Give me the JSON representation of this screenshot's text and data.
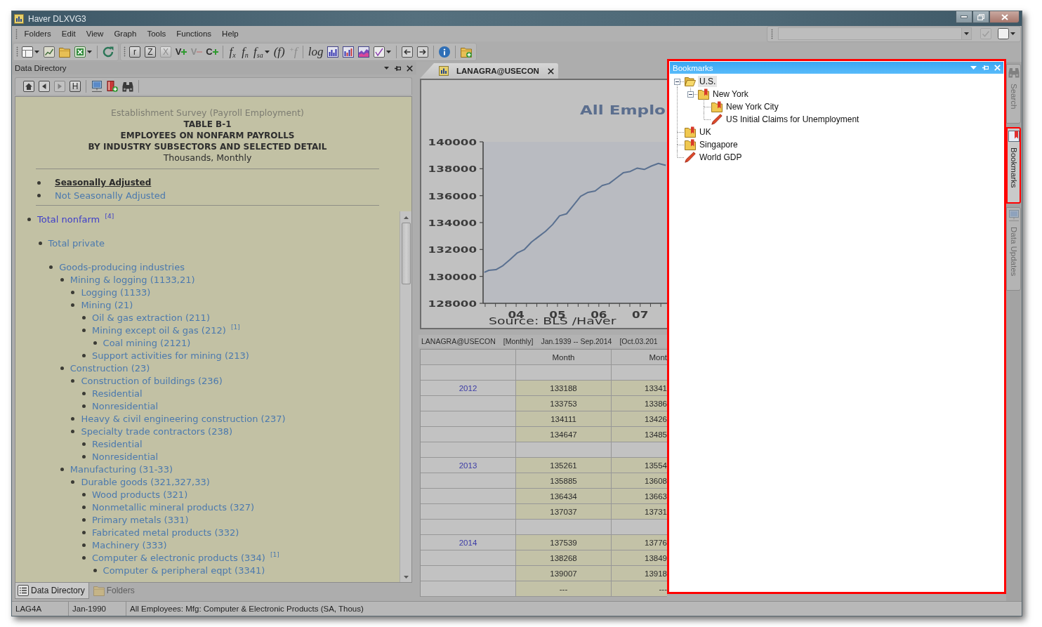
{
  "window": {
    "title": "Haver DLXVG3"
  },
  "menu": [
    "Folders",
    "Edit",
    "View",
    "Graph",
    "Tools",
    "Functions",
    "Help"
  ],
  "quick_toolbar": {
    "buttons": [
      {
        "kind": "icon",
        "disabled": true
      },
      {
        "kind": "icon",
        "disabled": false,
        "menu": true
      }
    ]
  },
  "toolbars": [
    {
      "groups": [
        {
          "buttons": [
            {
              "kind": "icon",
              "menu": true,
              "disabled": false
            },
            {
              "kind": "icon",
              "disabled": false
            },
            {
              "kind": "icon",
              "disabled": false
            },
            {
              "kind": "icon",
              "menu": true,
              "disabled": false
            }
          ]
        },
        {
          "buttons": [
            {
              "kind": "icon",
              "disabled": false
            }
          ]
        }
      ]
    },
    {
      "groups": [
        {
          "buttons": [
            {
              "kind": "boxed",
              "label": "r",
              "disabled": false
            },
            {
              "kind": "boxed",
              "label": "Z",
              "disabled": false
            },
            {
              "kind": "boxed",
              "label": "X",
              "disabled": true
            },
            {
              "kind": "add",
              "label": "V",
              "disabled": false
            },
            {
              "kind": "remove",
              "label": "V",
              "disabled": true
            },
            {
              "kind": "add",
              "label": "C",
              "disabled": false
            }
          ]
        },
        {
          "buttons": [
            {
              "kind": "formula",
              "label": "f$_{x}$",
              "disabled": false
            },
            {
              "kind": "formula",
              "label": "f$_{n}$",
              "disabled": false
            },
            {
              "kind": "formula",
              "label": "f$_{sa}$",
              "menu": true,
              "disabled": false
            },
            {
              "kind": "formula",
              "label": "(f)",
              "disabled": false
            },
            {
              "kind": "formula",
              "label": "$^{+}$f",
              "disabled": true
            }
          ]
        },
        {
          "buttons": [
            {
              "kind": "formula",
              "label": "log",
              "disabled": false
            },
            {
              "kind": "icon",
              "disabled": false
            },
            {
              "kind": "icon",
              "disabled": false
            },
            {
              "kind": "icon",
              "disabled": false
            },
            {
              "kind": "icon",
              "menu": true,
              "disabled": false
            }
          ]
        },
        {
          "buttons": [
            {
              "kind": "icon",
              "disabled": false
            },
            {
              "kind": "icon",
              "disabled": false
            }
          ]
        },
        {
          "buttons": [
            {
              "kind": "icon",
              "disabled": false
            }
          ]
        },
        {
          "buttons": [
            {
              "kind": "icon",
              "disabled": false
            }
          ]
        }
      ]
    }
  ],
  "data_directory": {
    "title": "Data Directory",
    "nav": {
      "groups": [
        {
          "buttons": [
            {
              "kind": "icon",
              "disabled": false
            },
            {
              "kind": "icon",
              "disabled": false
            },
            {
              "kind": "icon",
              "disabled": true
            },
            {
              "kind": "boxed",
              "label": "H",
              "disabled": false
            }
          ]
        },
        {
          "buttons": [
            {
              "kind": "icon",
              "disabled": false
            },
            {
              "kind": "icon",
              "disabled": false
            },
            {
              "kind": "icon",
              "disabled": false
            }
          ]
        }
      ]
    },
    "page": {
      "intro": "Establishment Survey (Payroll Employment)",
      "headings": [
        "TABLE B-1",
        "EMPLOYEES ON NONFARM PAYROLLS",
        "BY INDUSTRY SUBSECTORS AND SELECTED DETAIL"
      ],
      "units": "Thousands, Monthly",
      "adjustments": [
        {
          "label": "Seasonally Adjusted",
          "selected": true
        },
        {
          "label": "Not Seasonally Adjusted",
          "selected": false
        }
      ],
      "series": [
        {
          "label": "Total nonfarm $^{[4]}$",
          "visited": true,
          "children": [
            {
              "label": "Total private",
              "visited": false,
              "children": [
                {
                  "label": "Goods-producing industries",
                  "visited": false,
                  "children": [
                    {
                      "label": "Mining & logging (1133,21)",
                      "visited": false,
                      "children": [
                        {
                          "label": "Logging (1133)",
                          "visited": false
                        },
                        {
                          "label": "Mining (21)",
                          "visited": false,
                          "children": [
                            {
                              "label": "Oil & gas extraction (211)",
                              "visited": false
                            },
                            {
                              "label": "Mining except oil & gas (212) $^{[1]}$",
                              "visited": false,
                              "children": [
                                {
                                  "label": "Coal mining (2121)",
                                  "visited": false
                                }
                              ]
                            },
                            {
                              "label": "Support activities for mining (213)",
                              "visited": false
                            }
                          ]
                        }
                      ]
                    },
                    {
                      "label": "Construction (23)",
                      "visited": false,
                      "children": [
                        {
                          "label": "Construction of buildings (236)",
                          "visited": false,
                          "children": [
                            {
                              "label": "Residential",
                              "visited": false
                            },
                            {
                              "label": "Nonresidential",
                              "visited": false
                            }
                          ]
                        },
                        {
                          "label": "Heavy & civil engineering construction (237)",
                          "visited": false
                        },
                        {
                          "label": "Specialty trade contractors (238)",
                          "visited": false,
                          "children": [
                            {
                              "label": "Residential",
                              "visited": false
                            },
                            {
                              "label": "Nonresidential",
                              "visited": false
                            }
                          ]
                        }
                      ]
                    },
                    {
                      "label": "Manufacturing (31-33)",
                      "visited": false,
                      "children": [
                        {
                          "label": "Durable goods (321,327,33)",
                          "visited": false,
                          "children": [
                            {
                              "label": "Wood products (321)",
                              "visited": false
                            },
                            {
                              "label": "Nonmetallic mineral products (327)",
                              "visited": false
                            },
                            {
                              "label": "Primary metals (331)",
                              "visited": false
                            },
                            {
                              "label": "Fabricated metal products (332)",
                              "visited": false
                            },
                            {
                              "label": "Machinery (333)",
                              "visited": false
                            },
                            {
                              "label": "Computer & electronic products (334) $^{[1]}$",
                              "visited": false,
                              "children": [
                                {
                                  "label": "Computer & peripheral eqpt (3341)",
                                  "visited": false
                                }
                              ]
                            }
                          ]
                        }
                      ]
                    }
                  ]
                }
              ]
            }
          ]
        }
      ]
    },
    "tabs": [
      {
        "label": "Data Directory",
        "selected": true
      },
      {
        "label": "Folders",
        "selected": false
      }
    ]
  },
  "document": {
    "tab": {
      "label": "LANAGRA@USECON",
      "selected": true
    },
    "chart": {
      "source": "Source: BLS /Haver",
      "chart_data": {
        "type": "line",
        "title": "All Emplo",
        "x": [
          2003.23,
          2003.34,
          2003.51,
          2003.68,
          2003.85,
          2004.03,
          2004.2,
          2004.37,
          2004.54,
          2004.71,
          2004.88,
          2005.05,
          2005.22,
          2005.39,
          2005.56,
          2005.74,
          2005.91,
          2006.08,
          2006.25,
          2006.42,
          2006.59,
          2006.76,
          2006.93,
          2007.1,
          2007.27,
          2007.44,
          2007.62
        ],
        "series": [
          {
            "color": "#5a7090",
            "values": [
              130300,
              130450,
              130500,
              130800,
              131250,
              131750,
              132000,
              132550,
              132950,
              133350,
              133850,
              134500,
              134650,
              135300,
              135950,
              136250,
              136350,
              136750,
              136900,
              137300,
              137700,
              137800,
              138050,
              137950,
              138200,
              138400,
              138250
            ]
          }
        ],
        "xlim": [
          2003.2,
          2007.65
        ],
        "ylim": [
          128000,
          140000
        ],
        "xticks": [
          {
            "value": 2004,
            "label": "04"
          },
          {
            "value": 2005,
            "label": "05"
          },
          {
            "value": 2006,
            "label": "06"
          },
          {
            "value": 2007,
            "label": "07"
          }
        ],
        "yticks": [
          128000,
          130000,
          132000,
          134000,
          136000,
          138000,
          140000
        ]
      }
    },
    "series_info": [
      "LANAGRA@USECON",
      "[Monthly]",
      "Jan.1939 -- Sep.2014",
      "[Oct.03.201"
    ],
    "table": {
      "columns": [
        "Month",
        "Mont"
      ],
      "rows": [
        {
          "kind": "spacer"
        },
        {
          "kind": "data",
          "label": "2012",
          "values": [
            "133188",
            "13341"
          ]
        },
        {
          "kind": "data",
          "values": [
            "133753",
            "13386"
          ]
        },
        {
          "kind": "data",
          "values": [
            "134111",
            "13426"
          ]
        },
        {
          "kind": "data",
          "values": [
            "134647",
            "13485"
          ]
        },
        {
          "kind": "spacer"
        },
        {
          "kind": "data",
          "label": "2013",
          "values": [
            "135261",
            "13554"
          ]
        },
        {
          "kind": "data",
          "values": [
            "135885",
            "13608"
          ]
        },
        {
          "kind": "data",
          "values": [
            "136434",
            "13663"
          ]
        },
        {
          "kind": "data",
          "values": [
            "137037",
            "13731"
          ]
        },
        {
          "kind": "spacer"
        },
        {
          "kind": "data",
          "label": "2014",
          "values": [
            "137539",
            "13776"
          ]
        },
        {
          "kind": "data",
          "values": [
            "138268",
            "13849"
          ]
        },
        {
          "kind": "data",
          "values": [
            "139007",
            "13918"
          ]
        },
        {
          "kind": "data",
          "values": [
            "---",
            "---"
          ]
        }
      ]
    }
  },
  "bookmarks": {
    "title": "Bookmarks",
    "highlighted": true,
    "items": [
      {
        "label": "U.S.",
        "kind": "open-folder",
        "selected": true,
        "expanded": true,
        "children": [
          {
            "label": "New York",
            "kind": "folder",
            "selected": false,
            "expanded": true,
            "children": [
              {
                "label": "New York City",
                "kind": "folder",
                "selected": false
              },
              {
                "label": "US Initial Claims for Unemployment",
                "kind": "bookmark",
                "selected": false
              }
            ]
          }
        ]
      },
      {
        "label": "UK",
        "kind": "folder",
        "selected": false
      },
      {
        "label": "Singapore",
        "kind": "folder",
        "selected": false
      },
      {
        "label": "World GDP",
        "kind": "bookmark",
        "selected": false
      }
    ]
  },
  "side_tabs": [
    {
      "label": "Search",
      "selected": false,
      "highlighted": false
    },
    {
      "label": "Bookmarks",
      "selected": true,
      "highlighted": true
    },
    {
      "label": "Data Updates",
      "selected": false,
      "highlighted": false
    }
  ],
  "status_bar": [
    "LAG4A",
    "Jan-1990",
    "All Employees: Mfg: Computer & Electronic Products (SA, Thous)"
  ]
}
